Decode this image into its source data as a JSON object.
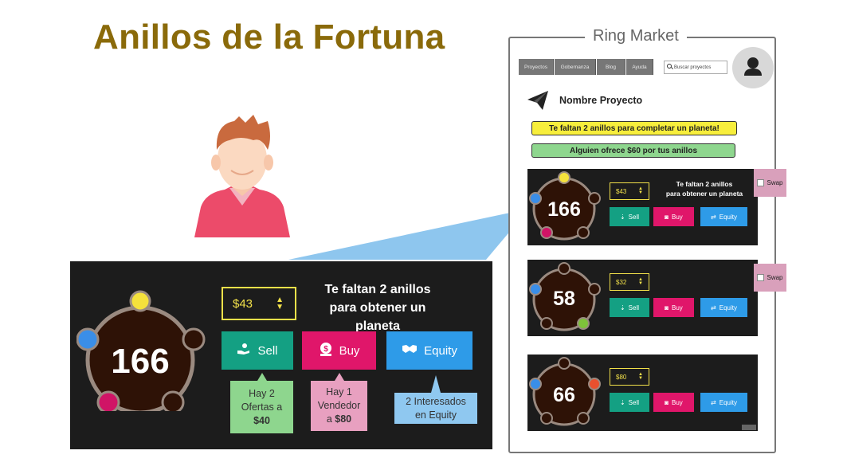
{
  "title": "Anillos de la Fortuna",
  "zoom_panel": {
    "ring_value": "166",
    "price": "$43",
    "message_line1": "Te faltan 2 anillos",
    "message_line2": "para obtener  un planeta",
    "buttons": {
      "sell": "Sell",
      "buy": "Buy",
      "equity": "Equity"
    },
    "tips": {
      "sell_line1": "Hay 2",
      "sell_line2": "Ofertas a",
      "sell_amount": "$40",
      "buy_line1": "Hay 1",
      "buy_line2": "Vendedor",
      "buy_line3_prefix": "a ",
      "buy_amount": "$80",
      "equity_line1": "2 Interesados",
      "equity_line2": "en Equity"
    }
  },
  "mockup": {
    "frame_title": "Ring Market",
    "nav": [
      "Proyectos",
      "Gobernanza",
      "Blog",
      "Ayuda"
    ],
    "search_placeholder": "Buscar proyectos",
    "project_name": "Nombre Proyecto",
    "notice_yellow": "Te faltan 2 anillos para completar un planeta!",
    "notice_green": "Alguien ofrece $60 por tus anillos",
    "swap_label": "Swap",
    "cards": [
      {
        "value": "166",
        "price": "$43",
        "message_line1": "Te faltan 2 anillos",
        "message_line2": "para obtener  un planeta",
        "sell": "Sell",
        "buy": "Buy",
        "equity": "Equity"
      },
      {
        "value": "58",
        "price": "$32",
        "sell": "Sell",
        "buy": "Buy",
        "equity": "Equity"
      },
      {
        "value": "66",
        "price": "$80",
        "sell": "Sell",
        "buy": "Buy",
        "equity": "Equity"
      }
    ]
  },
  "colors": {
    "title": "#8a6a0a",
    "panel_bg": "#1c1c1c",
    "ring_fill": "#2e1206",
    "ring_border": "#9a8a80",
    "sell": "#14a083",
    "buy": "#e0166a",
    "equity": "#2e9be8",
    "price_border": "#f2e14a",
    "beam": "#8ec6ee"
  }
}
